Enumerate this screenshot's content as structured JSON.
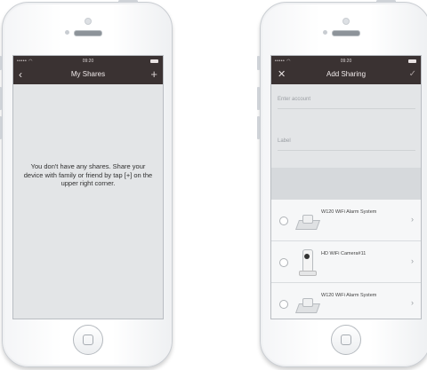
{
  "left_screen": {
    "status": {
      "signal": "••••• ◠",
      "time": "09:20"
    },
    "nav": {
      "back_icon": "‹",
      "title": "My Shares",
      "add_icon": "+"
    },
    "empty_message": "You don't have any shares. Share your device with family or friend by tap [+] on the upper right corner."
  },
  "right_screen": {
    "status": {
      "signal": "••••• ◠",
      "time": "09:20"
    },
    "nav": {
      "close_icon": "✕",
      "title": "Add Sharing",
      "confirm_icon": "✓"
    },
    "fields": {
      "account_placeholder": "Enter account",
      "label_placeholder": "Label"
    },
    "devices": [
      {
        "name": "W120 WiFi Alarm System",
        "icon": "alarm-hub-icon"
      },
      {
        "name": "HD WiFi Camera#11",
        "icon": "camera-icon"
      },
      {
        "name": "W120 WiFi Alarm System",
        "icon": "alarm-hub-icon"
      }
    ],
    "chevron": "›"
  }
}
